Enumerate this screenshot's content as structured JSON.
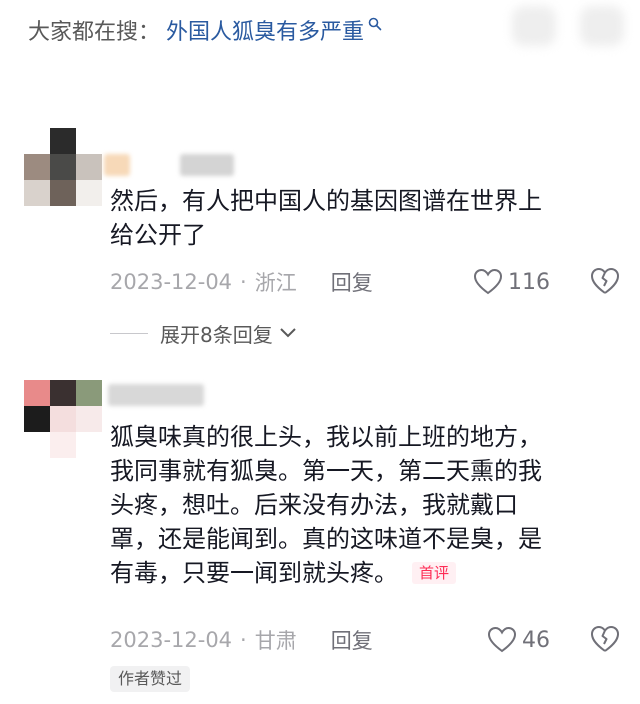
{
  "search": {
    "prefix": "大家都在搜：",
    "query": "外国人狐臭有多严重"
  },
  "comments": [
    {
      "text": "然后，有人把中国人的基因图谱在世界上\n给公开了",
      "date": "2023-12-04",
      "separator": "·",
      "location": "浙江",
      "reply_label": "回复",
      "likes": "116",
      "expand_label": "展开8条回复"
    },
    {
      "text": "狐臭味真的很上头，我以前上班的地方，\n我同事就有狐臭。第一天，第二天熏的我\n头疼，想吐。后来没有办法，我就戴口\n罩，还是能闻到。真的这味道不是臭，是\n有毒，只要一闻到就头疼。",
      "badge": "首评",
      "date": "2023-12-04",
      "separator": "·",
      "location": "甘肃",
      "reply_label": "回复",
      "likes": "46",
      "author_liked": "作者赞过"
    }
  ],
  "colors": {
    "query_blue": "#2a5aa0",
    "badge_red": "#fe2c55",
    "meta_gray": "#a7a7ab"
  }
}
